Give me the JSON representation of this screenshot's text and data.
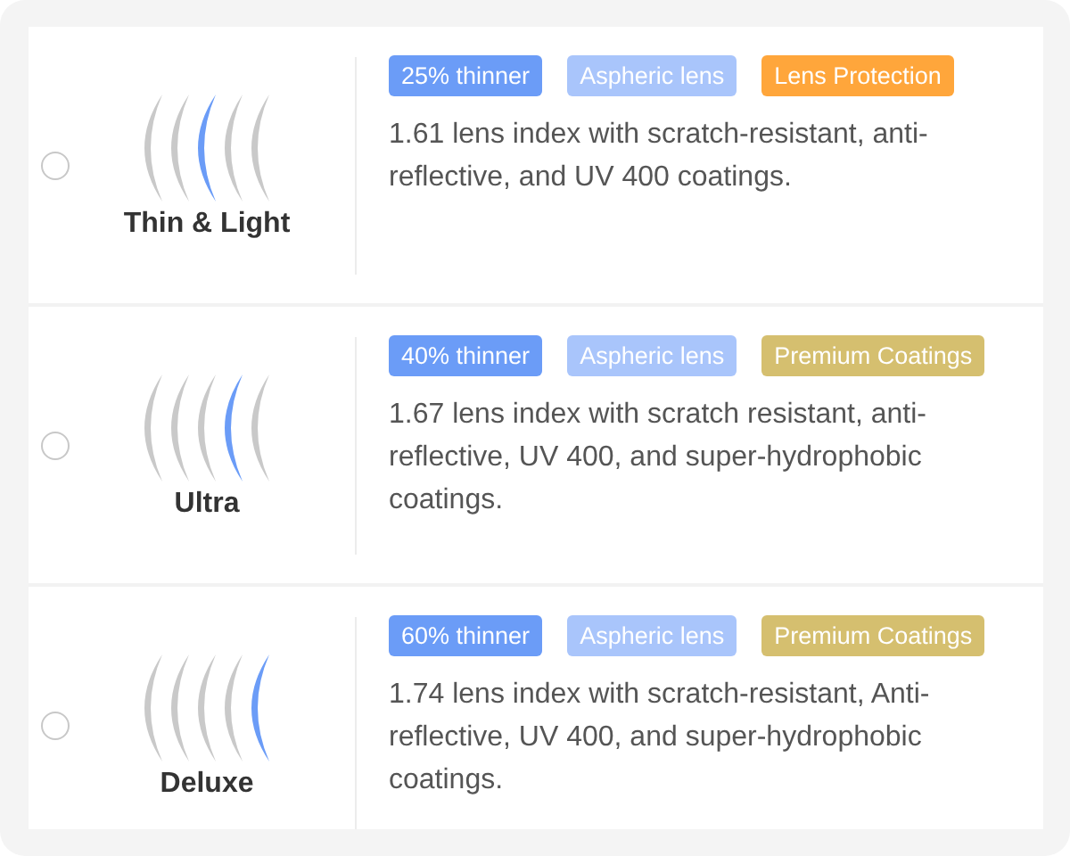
{
  "options": [
    {
      "name": "Thin & Light",
      "selected": false,
      "arcs": [
        {
          "highlighted": false
        },
        {
          "highlighted": false
        },
        {
          "highlighted": true
        },
        {
          "highlighted": false
        },
        {
          "highlighted": false
        }
      ],
      "tags": [
        {
          "label": "25% thinner",
          "color": "#6b9cf7"
        },
        {
          "label": "Aspheric lens",
          "color": "#a9c5fb"
        },
        {
          "label": "Lens Protection",
          "color": "#ffa63b"
        }
      ],
      "description": "1.61 lens index with scratch-resistant, anti-reflective, and UV 400 coatings."
    },
    {
      "name": "Ultra",
      "selected": false,
      "arcs": [
        {
          "highlighted": false
        },
        {
          "highlighted": false
        },
        {
          "highlighted": false
        },
        {
          "highlighted": true
        },
        {
          "highlighted": false
        }
      ],
      "tags": [
        {
          "label": "40% thinner",
          "color": "#6b9cf7"
        },
        {
          "label": "Aspheric lens",
          "color": "#a9c5fb"
        },
        {
          "label": "Premium Coatings",
          "color": "#d5bf6f"
        }
      ],
      "description": "1.67 lens index with scratch resistant, anti-reflective, UV 400, and super-hydrophobic coatings."
    },
    {
      "name": "Deluxe",
      "selected": false,
      "arcs": [
        {
          "highlighted": false
        },
        {
          "highlighted": false
        },
        {
          "highlighted": false
        },
        {
          "highlighted": false
        },
        {
          "highlighted": true
        }
      ],
      "tags": [
        {
          "label": "60% thinner",
          "color": "#6b9cf7"
        },
        {
          "label": "Aspheric lens",
          "color": "#a9c5fb"
        },
        {
          "label": "Premium Coatings",
          "color": "#d5bf6f"
        }
      ],
      "description": "1.74 lens index with scratch-resistant, Anti-reflective, UV 400, and super-hydrophobic coatings."
    }
  ]
}
